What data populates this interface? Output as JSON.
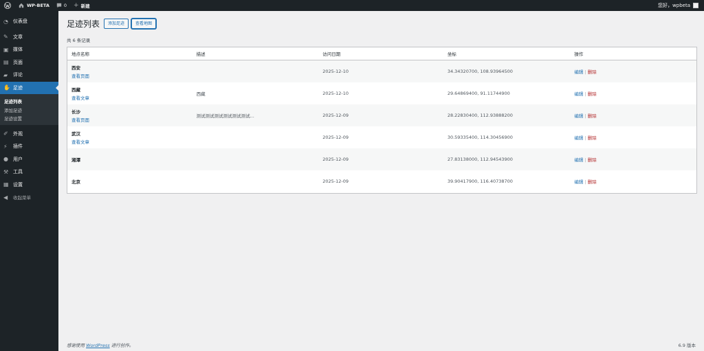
{
  "adminbar": {
    "wp_icon": "wordpress-logo-icon",
    "site_name": "WP-BETA",
    "comments_count": "0",
    "new_label": "新建",
    "greeting": "您好，wpbeta"
  },
  "sidebar": {
    "items": [
      {
        "label": "仪表盘",
        "icon": "dashboard-icon"
      },
      {
        "label": "文章",
        "icon": "pin-icon"
      },
      {
        "label": "媒体",
        "icon": "media-icon"
      },
      {
        "label": "页面",
        "icon": "page-icon"
      },
      {
        "label": "评论",
        "icon": "comment-icon"
      },
      {
        "label": "足迹",
        "icon": "footprint-icon"
      },
      {
        "label": "外观",
        "icon": "brush-icon"
      },
      {
        "label": "插件",
        "icon": "plugin-icon"
      },
      {
        "label": "用户",
        "icon": "user-icon"
      },
      {
        "label": "工具",
        "icon": "wrench-icon"
      },
      {
        "label": "设置",
        "icon": "settings-icon"
      },
      {
        "label": "收起菜单",
        "icon": "collapse-icon"
      }
    ],
    "submenu": [
      "足迹列表",
      "添加足迹",
      "足迹设置"
    ]
  },
  "page": {
    "title": "足迹列表",
    "add_button": "添加足迹",
    "map_button": "查看地图",
    "count_text": "共 6 条记录"
  },
  "table": {
    "headers": [
      "地点名称",
      "描述",
      "访问日期",
      "坐标",
      "操作"
    ],
    "rows": [
      {
        "name": "西安",
        "link": "查看页面",
        "desc": "",
        "date": "2025-12-10",
        "coords": "34.34320700, 108.93964500"
      },
      {
        "name": "西藏",
        "link": "查看文章",
        "desc": "西藏",
        "date": "2025-12-10",
        "coords": "29.64869400, 91.11744900"
      },
      {
        "name": "长沙",
        "link": "查看页面",
        "desc": "测试测试测试测试测试测试...",
        "date": "2025-12-09",
        "coords": "28.22830400, 112.93888200"
      },
      {
        "name": "武汉",
        "link": "查看文章",
        "desc": "",
        "date": "2025-12-09",
        "coords": "30.59335400, 114.30456900"
      },
      {
        "name": "湘潭",
        "link": "",
        "desc": "",
        "date": "2025-12-09",
        "coords": "27.83138000, 112.94543900"
      },
      {
        "name": "北京",
        "link": "",
        "desc": "",
        "date": "2025-12-09",
        "coords": "39.90417900, 116.40738700"
      }
    ],
    "edit_label": "编辑",
    "sep": "|",
    "delete_label": "删除"
  },
  "footer": {
    "thanks_prefix": "感谢使用",
    "wordpress_link": "WordPress",
    "thanks_suffix": "进行创作。",
    "version": "6.9 版本"
  }
}
